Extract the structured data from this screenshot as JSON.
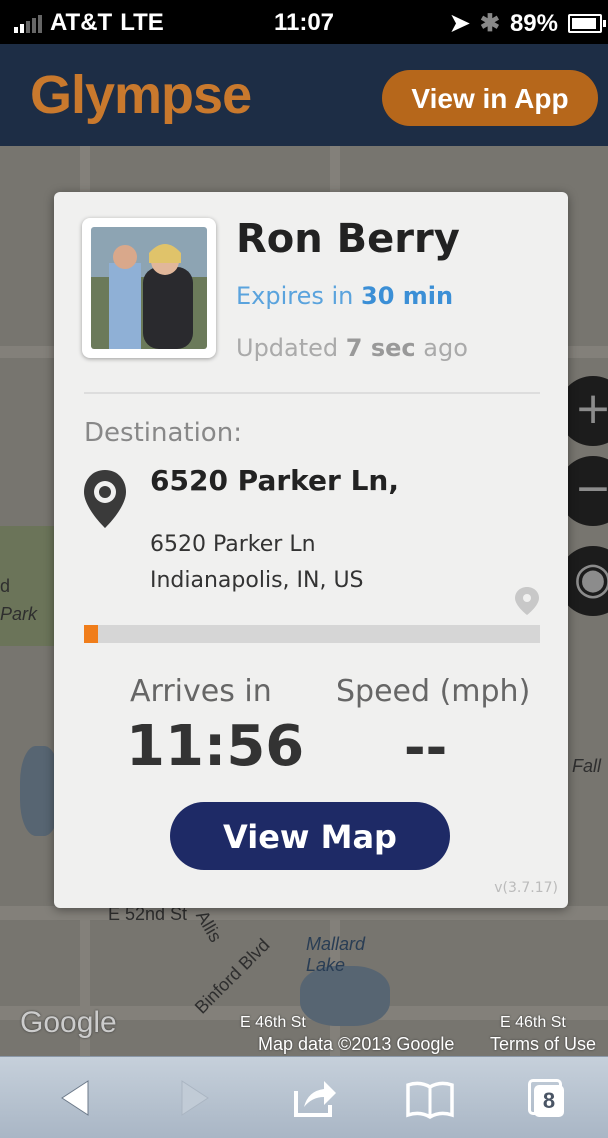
{
  "status": {
    "carrier": "AT&T",
    "network": "LTE",
    "time": "11:07",
    "battery": "89%"
  },
  "header": {
    "logo": "Glympse",
    "view_in_app": "View in App"
  },
  "card": {
    "name": "Ron Berry",
    "expires_prefix": "Expires in ",
    "expires_value": "30 min",
    "updated_prefix": "Updated ",
    "updated_value": "7 sec",
    "updated_suffix": " ago",
    "destination_label": "Destination:",
    "address_title": "6520 Parker Ln,",
    "address_line1": "6520 Parker Ln",
    "address_line2": "Indianapolis, IN, US",
    "progress": 0.03,
    "arrives_label": "Arrives in",
    "arrives_value": "11:56",
    "speed_label": "Speed (mph)",
    "speed_value": "--",
    "view_map": "View Map",
    "version": "v(3.7.17)"
  },
  "map": {
    "street_52nd": "E 52nd St",
    "street_allis": "Allis",
    "street_binford": "Binford Blvd",
    "lake": "Mallard Lake",
    "street_46th": "E 46th St",
    "street_46th_right": "E 46th St",
    "attribution": "Map data ©2013 Google",
    "terms": "Terms of Use",
    "google": "Google",
    "park": "Park",
    "fall": "Fall",
    "d_label": "d"
  },
  "toolbar": {
    "tabs_count": "8"
  }
}
